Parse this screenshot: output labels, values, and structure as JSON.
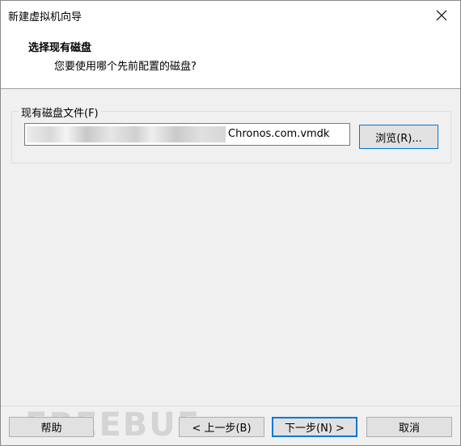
{
  "window": {
    "title": "新建虚拟机向导",
    "close_icon": "close-icon"
  },
  "header": {
    "title": "选择现有磁盘",
    "subtitle": "您要使用哪个先前配置的磁盘?"
  },
  "disk_group": {
    "label": "现有磁盘文件(F)",
    "path_value": "Chronos.com.vmdk",
    "browse_label": "浏览(R)..."
  },
  "buttons": {
    "help": "帮助",
    "back": "< 上一步(B)",
    "next": "下一步(N) >",
    "cancel": "取消"
  },
  "watermark": "FREEBUF",
  "colors": {
    "accent": "#0078d7",
    "button_bg": "#e1e1e1",
    "window_bg": "#f0f0f0"
  }
}
